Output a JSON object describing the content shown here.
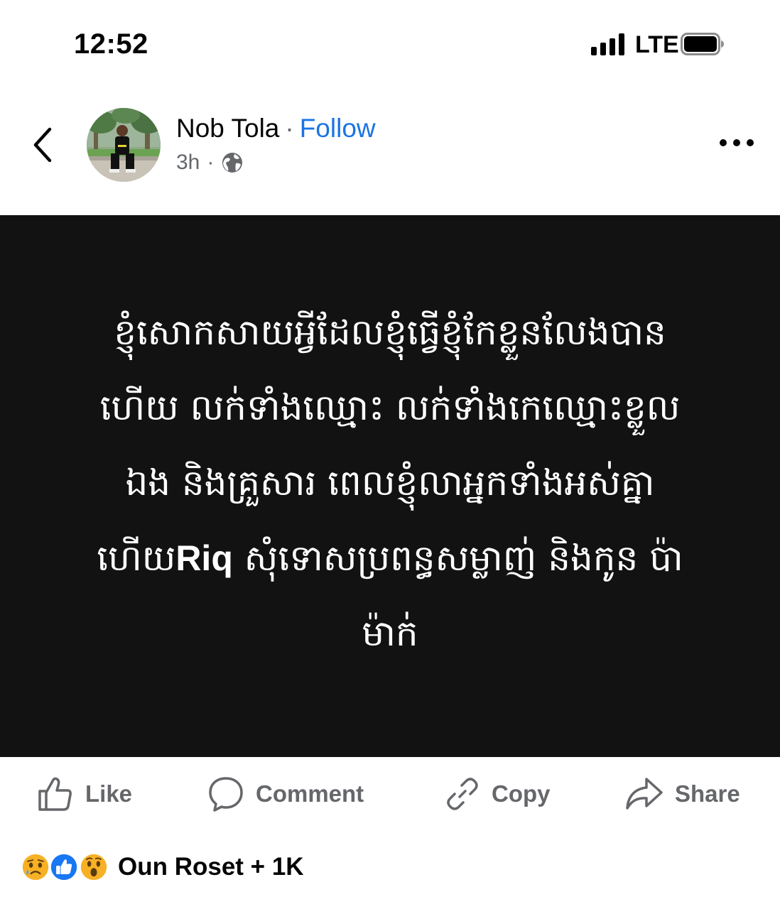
{
  "status_bar": {
    "time": "12:52",
    "network": "LTE"
  },
  "header": {
    "author": "Nob Tola",
    "separator": "·",
    "follow_label": "Follow",
    "timestamp": "3h",
    "meta_separator": "·",
    "audience_icon": "globe-icon"
  },
  "post": {
    "background_color": "#121212",
    "text_color": "#ffffff",
    "lines": [
      {
        "parts": [
          {
            "text": "ខ្ញុំសោកសាយអ្វីដែលខ្ញុំធ្វើខ្ញុំកែខ្លួនលែងបាន",
            "bold": false
          }
        ]
      },
      {
        "parts": [
          {
            "text": "ហើយ លក់ទាំងឈ្មោះ លក់ទាំងកេឈ្មោះខ្លួល",
            "bold": false
          }
        ]
      },
      {
        "parts": [
          {
            "text": "ឯង និងគ្រួសារ ពេលខ្ញុំលាអ្នកទាំងអស់គ្នា",
            "bold": false
          }
        ]
      },
      {
        "parts": [
          {
            "text": "ហើយ",
            "bold": false
          },
          {
            "text": "Riq",
            "bold": true
          },
          {
            "text": " សុំទោសប្រពន្ធសម្លាញ់ និងកូន ប៉ា",
            "bold": false
          }
        ]
      },
      {
        "parts": [
          {
            "text": "ម៉ាក់",
            "bold": false
          }
        ]
      }
    ]
  },
  "actions": {
    "like": "Like",
    "comment": "Comment",
    "copy": "Copy",
    "share": "Share"
  },
  "reactions": {
    "icons": [
      "sad-reaction",
      "like-reaction",
      "wow-reaction"
    ],
    "summary": "Oun Roset + 1K"
  },
  "colors": {
    "link_blue": "#1b74e4",
    "secondary_text": "#65676b",
    "like_blue": "#1877f2",
    "reaction_yellow": "#f7b125"
  }
}
